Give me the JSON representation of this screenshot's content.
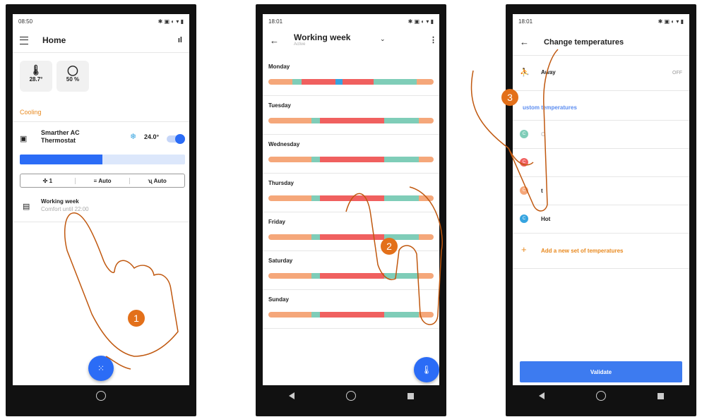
{
  "window_controls": {
    "external_icon": "external-link-icon",
    "close_icon": "close-icon",
    "close_glyph": "✕",
    "external_glyph": "⧉"
  },
  "steps": {
    "one": "1",
    "two": "2",
    "three": "3"
  },
  "screen1": {
    "time": "08:50",
    "title": "Home",
    "tiles": [
      {
        "icon": "thermometer-icon",
        "value": "28.7°"
      },
      {
        "icon": "drop-icon",
        "value": "50 %"
      }
    ],
    "section": "Cooling",
    "device": {
      "name_line1": "Smarther AC",
      "name_line2": "Thermostat",
      "setpoint": "24.0°",
      "on": true
    },
    "level": 0.5,
    "modes": {
      "fan": "1",
      "swing": "Auto",
      "mode": "Auto"
    },
    "program": {
      "title": "Working week",
      "subtitle": "Comfort until 22:00"
    }
  },
  "screen2": {
    "time": "18:01",
    "title": "Working week",
    "subtitle": "Active",
    "days": [
      {
        "name": "Monday",
        "segments": [
          [
            "#f5a77a",
            1
          ],
          [
            "#7fcdb8",
            0.4
          ],
          [
            "#f0605f",
            1.4
          ],
          [
            "#36a4e0",
            0.3
          ],
          [
            "#f0605f",
            1.3
          ],
          [
            "#7fcdb8",
            1.8
          ],
          [
            "#f5a77a",
            0.7
          ]
        ]
      },
      {
        "name": "Tuesday",
        "segments": [
          [
            "#f5a77a",
            2
          ],
          [
            "#7fcdb8",
            0.4
          ],
          [
            "#f0605f",
            3
          ],
          [
            "#7fcdb8",
            1.6
          ],
          [
            "#f5a77a",
            0.7
          ]
        ]
      },
      {
        "name": "Wednesday",
        "segments": [
          [
            "#f5a77a",
            2
          ],
          [
            "#7fcdb8",
            0.4
          ],
          [
            "#f0605f",
            3
          ],
          [
            "#7fcdb8",
            1.6
          ],
          [
            "#f5a77a",
            0.7
          ]
        ]
      },
      {
        "name": "Thursday",
        "segments": [
          [
            "#f5a77a",
            2
          ],
          [
            "#7fcdb8",
            0.4
          ],
          [
            "#f0605f",
            3
          ],
          [
            "#7fcdb8",
            1.6
          ],
          [
            "#f5a77a",
            0.7
          ]
        ]
      },
      {
        "name": "Friday",
        "segments": [
          [
            "#f5a77a",
            2
          ],
          [
            "#7fcdb8",
            0.4
          ],
          [
            "#f0605f",
            3
          ],
          [
            "#7fcdb8",
            1.6
          ],
          [
            "#f5a77a",
            0.7
          ]
        ]
      },
      {
        "name": "Saturday",
        "segments": [
          [
            "#f5a77a",
            2
          ],
          [
            "#7fcdb8",
            0.4
          ],
          [
            "#f0605f",
            3
          ],
          [
            "#7fcdb8",
            1.6
          ],
          [
            "#f5a77a",
            0.7
          ]
        ]
      },
      {
        "name": "Sunday",
        "segments": [
          [
            "#f5a77a",
            2
          ],
          [
            "#7fcdb8",
            0.4
          ],
          [
            "#f0605f",
            3
          ],
          [
            "#7fcdb8",
            1.6
          ],
          [
            "#f5a77a",
            0.7
          ]
        ]
      }
    ]
  },
  "screen3": {
    "time": "18:01",
    "title": "Change temperatures",
    "away_label": "Away",
    "away_state": "OFF",
    "custom_label": "ustom temperatures",
    "items": [
      {
        "label": "C",
        "color": "#7fcdb8",
        "letter": "C"
      },
      {
        "label": "",
        "color": "#f0605f",
        "letter": "C"
      },
      {
        "label": "t",
        "color": "#f5a77a",
        "letter": "C"
      },
      {
        "label": "Hot",
        "color": "#36a4e0",
        "letter": "C"
      }
    ],
    "add_label": "Add a new set of temperatures",
    "validate_label": "Validate"
  },
  "colors": {
    "accent": "#2b6cf6",
    "orange": "#e8891f",
    "hand": "#c0580f"
  }
}
